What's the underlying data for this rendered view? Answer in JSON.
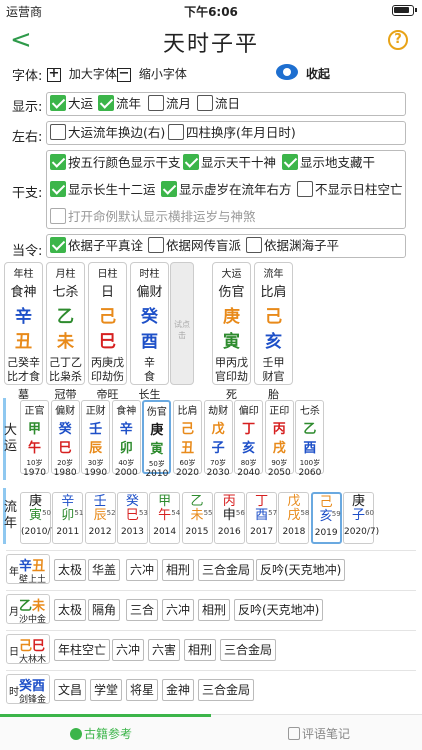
{
  "status": {
    "carrier": "运营商",
    "time": "下午6:06"
  },
  "nav": {
    "back": "<",
    "title": "天时子平",
    "help": "?"
  },
  "font": {
    "label": "字体:",
    "increase": "加大字体",
    "decrease": "缩小字体",
    "increase_sign": "+",
    "decrease_sign": "−",
    "collapse": "收起"
  },
  "display": {
    "label": "显示:",
    "options": [
      "大运",
      "流年",
      "流月",
      "流日"
    ],
    "checked": [
      true,
      true,
      false,
      false
    ]
  },
  "lr": {
    "label": "左右:",
    "options": [
      "大运流年换边(右)",
      "四柱换序(年月日时)"
    ]
  },
  "ganzhi": {
    "label": "干支:",
    "options": [
      "按五行颜色显示干支",
      "显示天干十神",
      "显示地支藏干",
      "显示长生十二运",
      "显示虚岁在流年右方",
      "不显示日柱空亡",
      "打开命例默认显示横排运岁与神煞"
    ]
  },
  "dangling": {
    "label": "当令:",
    "options": [
      "依据子平真诠",
      "依据网传盲派",
      "依据渊海子平"
    ]
  },
  "pillars": [
    {
      "title": "年柱",
      "god": "食神",
      "stem": "辛",
      "branch": "丑",
      "hidden1": "己癸辛",
      "hidden2": "比才食",
      "stage": "墓"
    },
    {
      "title": "月柱",
      "god": "七杀",
      "stem": "乙",
      "branch": "未",
      "hidden1": "己丁乙",
      "hidden2": "比枭杀",
      "stage": "冠带"
    },
    {
      "title": "日柱",
      "god": "日",
      "stem": "己",
      "branch": "巳",
      "hidden1": "丙庚戊",
      "hidden2": "印劫伤",
      "stage": "帝旺"
    },
    {
      "title": "时柱",
      "god": "偏财",
      "stem": "癸",
      "branch": "酉",
      "hidden1": "辛",
      "hidden2": "食",
      "stage": "长生"
    },
    {
      "title": "大运",
      "god": "伤官",
      "stem": "庚",
      "branch": "寅",
      "hidden1": "甲丙戊",
      "hidden2": "官印劫",
      "stage": "死"
    },
    {
      "title": "流年",
      "god": "比肩",
      "stem": "己",
      "branch": "亥",
      "hidden1": "壬甲",
      "hidden2": "财官",
      "stage": "胎"
    }
  ],
  "mid_tip": "试点击",
  "dayun": {
    "label": "大运",
    "items": [
      {
        "god": "正官",
        "stem": "甲",
        "branch": "午",
        "age": "10岁",
        "year": "1970"
      },
      {
        "god": "偏财",
        "stem": "癸",
        "branch": "巳",
        "age": "20岁",
        "year": "1980"
      },
      {
        "god": "正财",
        "stem": "壬",
        "branch": "辰",
        "age": "30岁",
        "year": "1990"
      },
      {
        "god": "食神",
        "stem": "辛",
        "branch": "卯",
        "age": "40岁",
        "year": "2000"
      },
      {
        "god": "伤官",
        "stem": "庚",
        "branch": "寅",
        "age": "50岁",
        "year": "2010"
      },
      {
        "god": "比肩",
        "stem": "己",
        "branch": "丑",
        "age": "60岁",
        "year": "2020"
      },
      {
        "god": "劫财",
        "stem": "戊",
        "branch": "子",
        "age": "70岁",
        "year": "2030"
      },
      {
        "god": "偏印",
        "stem": "丁",
        "branch": "亥",
        "age": "80岁",
        "year": "2040"
      },
      {
        "god": "正印",
        "stem": "丙",
        "branch": "戌",
        "age": "90岁",
        "year": "2050"
      },
      {
        "god": "七杀",
        "stem": "乙",
        "branch": "酉",
        "age": "100岁",
        "year": "2060"
      }
    ]
  },
  "liunian": {
    "label": "流年",
    "items": [
      {
        "stem": "庚",
        "branch": "寅",
        "age": "50",
        "year": "(2010/7)"
      },
      {
        "stem": "辛",
        "branch": "卯",
        "age": "51",
        "year": "2011"
      },
      {
        "stem": "壬",
        "branch": "辰",
        "age": "52",
        "year": "2012"
      },
      {
        "stem": "癸",
        "branch": "巳",
        "age": "53",
        "year": "2013"
      },
      {
        "stem": "甲",
        "branch": "午",
        "age": "54",
        "year": "2014"
      },
      {
        "stem": "乙",
        "branch": "未",
        "age": "55",
        "year": "2015"
      },
      {
        "stem": "丙",
        "branch": "申",
        "age": "56",
        "year": "2016"
      },
      {
        "stem": "丁",
        "branch": "酉",
        "age": "57",
        "year": "2017"
      },
      {
        "stem": "戊",
        "branch": "戌",
        "age": "58",
        "year": "2018"
      },
      {
        "stem": "己",
        "branch": "亥",
        "age": "59",
        "year": "2019"
      },
      {
        "stem": "庚",
        "branch": "子",
        "age": "60",
        "year": "2020/7)"
      }
    ]
  },
  "relations": [
    {
      "pos": "年",
      "stem": "辛",
      "branch": "丑",
      "nayin": "壁上土",
      "tags": [
        "太极",
        "华盖",
        "六冲",
        "相刑",
        "三合金局",
        "反吟(天克地冲)"
      ]
    },
    {
      "pos": "月",
      "stem": "乙",
      "branch": "未",
      "nayin": "沙中金",
      "tags": [
        "太极",
        "隔角",
        "三合",
        "六冲",
        "相刑",
        "反吟(天克地冲)"
      ]
    },
    {
      "pos": "日",
      "stem": "己",
      "branch": "巳",
      "nayin": "大林木",
      "tags": [
        "年柱空亡",
        "六冲",
        "六害",
        "相刑",
        "三合金局"
      ]
    },
    {
      "pos": "时",
      "stem": "癸",
      "branch": "酉",
      "nayin": "剑锋金",
      "tags": [
        "文昌",
        "学堂",
        "将星",
        "金神",
        "三合金局"
      ]
    }
  ],
  "tabs": {
    "left": "古籍参考",
    "right": "评语笔记"
  }
}
